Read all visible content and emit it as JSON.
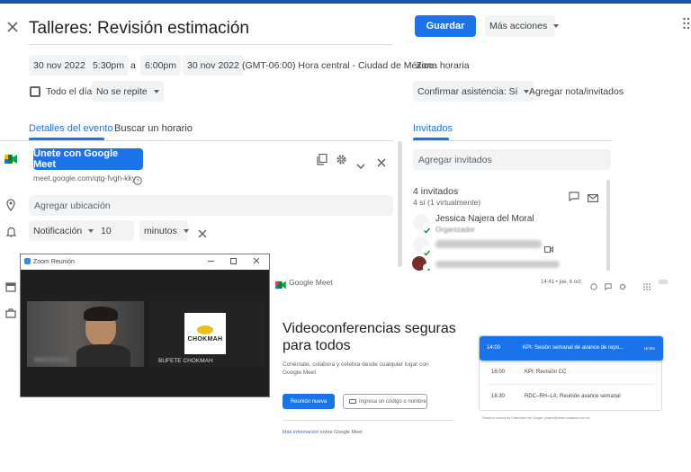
{
  "header": {
    "title": "Talleres: Revisión estimación",
    "save_label": "Guardar",
    "more_actions_label": "Más acciones"
  },
  "datetime": {
    "start_date": "30 nov 2022",
    "start_time": "5:30pm",
    "separator": "a",
    "end_time": "6:00pm",
    "end_date": "30 nov 2022",
    "timezone": "(GMT-06:00) Hora central - Ciudad de México",
    "timezone_link": "Zona horaria",
    "all_day_label": "Todo el día",
    "repeat_label": "No se repite"
  },
  "rsvp": {
    "confirm_label": "Confirmar asistencia: Sí",
    "add_note_label": "Agregar nota/invitados"
  },
  "tabs": {
    "details": "Detalles del evento",
    "find_time": "Buscar un horario",
    "guests": "Invitados"
  },
  "event": {
    "meet_button": "Únete con Google Meet",
    "meet_link": "meet.google.com/qtg-fvgh-kky",
    "location_placeholder": "Agregar ubicación",
    "notification_type": "Notificación",
    "notification_value": "10",
    "notification_unit": "minutos"
  },
  "guests": {
    "add_placeholder": "Agregar invitados",
    "count_label": "4 invitados",
    "summary": "4 sí (1 virtualmente)",
    "organizer_name": "Jessica Najera del Moral",
    "organizer_role": "Organizador"
  },
  "zoom": {
    "window_title": "Zoom Reunión",
    "participant_logo": "CHOKMAH",
    "participant_name": "BUFETE CHOKMAH"
  },
  "meet": {
    "logo_text": "Google Meet",
    "status_time": "14:41 • jue, 6 oct",
    "headline": "Videoconferencias seguras para todos",
    "subtext": "Conéctate, colabora y celebra desde cualquier lugar con Google Meet",
    "new_meeting": "Reunión nueva",
    "enter_code": "Ingresa un código o nombre",
    "more_info_link": "Más información",
    "more_info_rest": "sobre Google Meet",
    "upcoming": [
      {
        "time": "14:00",
        "title": "KPI: Sesión semanal de avance de repo...",
        "action": "Unirte"
      },
      {
        "time": "16:00",
        "title": "KPI: Revisión CC"
      },
      {
        "time": "16:30",
        "title": "RDC–RH–LA: Reunión avance semanal"
      }
    ],
    "calendar_note": "Desde tu cuenta de Calendario de Google: jnajera@beam-dosteca.com.mx"
  },
  "colors": {
    "accent": "#1a73e8",
    "topbar": "#1a56a8",
    "confirmed": "#1e8e3e"
  }
}
